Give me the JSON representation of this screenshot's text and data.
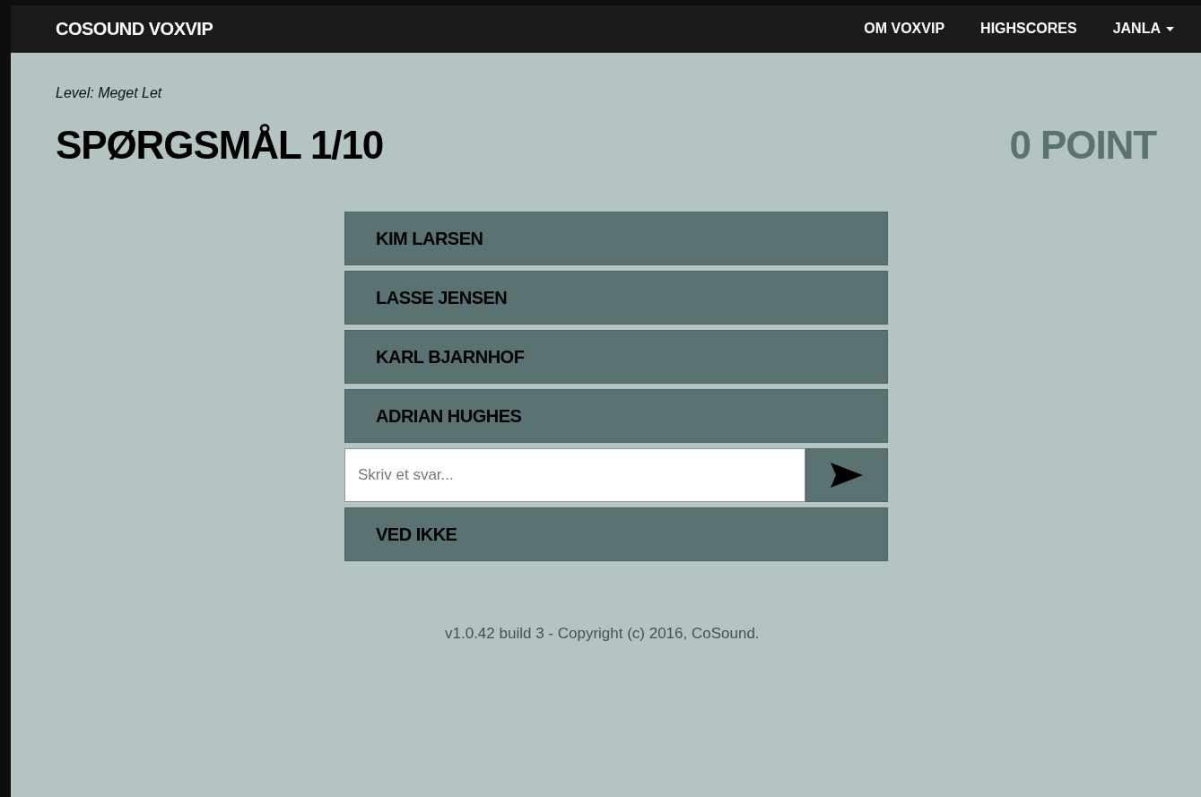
{
  "navbar": {
    "brand": "COSOUND VOXVIP",
    "links": [
      {
        "label": "OM VOXVIP",
        "kind": "link"
      },
      {
        "label": "HIGHSCORES",
        "kind": "link"
      },
      {
        "label": "JANLA",
        "kind": "dropdown"
      }
    ]
  },
  "level": "Level: Meget Let",
  "question": "SPØRGSMÅL 1/10",
  "score": "0 POINT",
  "options": [
    {
      "label": "KIM LARSEN"
    },
    {
      "label": "LASSE JENSEN"
    },
    {
      "label": "KARL BJARNHOF"
    },
    {
      "label": "ADRIAN HUGHES"
    }
  ],
  "answer": {
    "placeholder": "Skriv et svar..."
  },
  "skip": "VED IKKE",
  "footer": "v1.0.42 build 3 - Copyright (c) 2016, CoSound."
}
